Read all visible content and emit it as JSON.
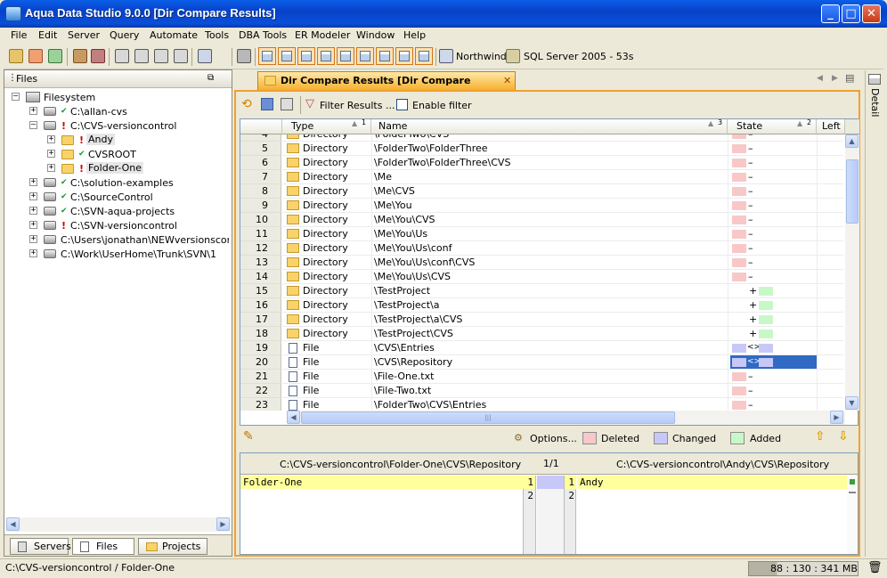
{
  "window": {
    "title": "Aqua Data Studio 9.0.0 [Dir Compare Results]"
  },
  "menu": [
    "File",
    "Edit",
    "Server",
    "Query",
    "Automate",
    "Tools",
    "DBA Tools",
    "ER Modeler",
    "Window",
    "Help"
  ],
  "toolbar": {
    "connection1": "Northwind",
    "connection2": "SQL Server 2005 - 53s"
  },
  "files_panel": {
    "title": "Files",
    "root": "Filesystem",
    "items": [
      {
        "label": "C:\\allan-cvs",
        "status": "ok"
      },
      {
        "label": "C:\\CVS-versioncontrol",
        "status": "changed"
      },
      {
        "label": "Andy",
        "status": "changed"
      },
      {
        "label": "CVSROOT",
        "status": "ok"
      },
      {
        "label": "Folder-One",
        "status": "changed"
      },
      {
        "label": "C:\\solution-examples",
        "status": "ok"
      },
      {
        "label": "C:\\SourceControl",
        "status": "ok"
      },
      {
        "label": "C:\\SVN-aqua-projects",
        "status": "ok"
      },
      {
        "label": "C:\\SVN-versioncontrol",
        "status": "changed"
      },
      {
        "label": "C:\\Users\\jonathan\\NEWversionscontro",
        "status": "none"
      },
      {
        "label": "C:\\Work\\UserHome\\Trunk\\SVN\\1",
        "status": "none"
      }
    ],
    "tabs": [
      "Servers",
      "Files",
      "Projects"
    ]
  },
  "doc_tab": {
    "label": "Dir Compare Results [Dir Compare Results]"
  },
  "side_tab": {
    "label": "Detail"
  },
  "filter": {
    "filter_label": "Filter Results ...",
    "enable_label": "Enable filter"
  },
  "grid": {
    "headers": {
      "type": "Type",
      "type_sort": "1",
      "name": "Name",
      "name_sort": "3",
      "state": "State",
      "state_sort": "2",
      "left": "Left"
    },
    "rows": [
      {
        "num": "4",
        "type": "Directory",
        "name": "\\FolderTwo\\CVS",
        "state": "deleted"
      },
      {
        "num": "5",
        "type": "Directory",
        "name": "\\FolderTwo\\FolderThree",
        "state": "deleted"
      },
      {
        "num": "6",
        "type": "Directory",
        "name": "\\FolderTwo\\FolderThree\\CVS",
        "state": "deleted"
      },
      {
        "num": "7",
        "type": "Directory",
        "name": "\\Me",
        "state": "deleted"
      },
      {
        "num": "8",
        "type": "Directory",
        "name": "\\Me\\CVS",
        "state": "deleted"
      },
      {
        "num": "9",
        "type": "Directory",
        "name": "\\Me\\You",
        "state": "deleted"
      },
      {
        "num": "10",
        "type": "Directory",
        "name": "\\Me\\You\\CVS",
        "state": "deleted"
      },
      {
        "num": "11",
        "type": "Directory",
        "name": "\\Me\\You\\Us",
        "state": "deleted"
      },
      {
        "num": "12",
        "type": "Directory",
        "name": "\\Me\\You\\Us\\conf",
        "state": "deleted"
      },
      {
        "num": "13",
        "type": "Directory",
        "name": "\\Me\\You\\Us\\conf\\CVS",
        "state": "deleted"
      },
      {
        "num": "14",
        "type": "Directory",
        "name": "\\Me\\You\\Us\\CVS",
        "state": "deleted"
      },
      {
        "num": "15",
        "type": "Directory",
        "name": "\\TestProject",
        "state": "added"
      },
      {
        "num": "16",
        "type": "Directory",
        "name": "\\TestProject\\a",
        "state": "added"
      },
      {
        "num": "17",
        "type": "Directory",
        "name": "\\TestProject\\a\\CVS",
        "state": "added"
      },
      {
        "num": "18",
        "type": "Directory",
        "name": "\\TestProject\\CVS",
        "state": "added"
      },
      {
        "num": "19",
        "type": "File",
        "name": "\\CVS\\Entries",
        "state": "changed"
      },
      {
        "num": "20",
        "type": "File",
        "name": "\\CVS\\Repository",
        "state": "changed_selected"
      },
      {
        "num": "21",
        "type": "File",
        "name": "\\File-One.txt",
        "state": "deleted"
      },
      {
        "num": "22",
        "type": "File",
        "name": "\\File-Two.txt",
        "state": "deleted"
      },
      {
        "num": "23",
        "type": "File",
        "name": "\\FolderTwo\\CVS\\Entries",
        "state": "deleted"
      }
    ],
    "symbols": {
      "deleted": "–",
      "added": "+",
      "changed": "<>"
    }
  },
  "legend": {
    "options": "Options...",
    "deleted": "Deleted",
    "changed": "Changed",
    "added": "Added",
    "colors": {
      "deleted": "#f8c8c8",
      "changed": "#c8c8f8",
      "added": "#c8f8c8",
      "highlight": "#ffff9c"
    }
  },
  "compare": {
    "left_path": "C:\\CVS-versioncontrol\\Folder-One\\CVS\\Repository",
    "right_path": "C:\\CVS-versioncontrol\\Andy\\CVS\\Repository",
    "position": "1/1",
    "left_lines": [
      {
        "n": "1",
        "text": "Folder-One"
      },
      {
        "n": "2",
        "text": ""
      }
    ],
    "right_lines": [
      {
        "n": "1",
        "text": "Andy"
      },
      {
        "n": "2",
        "text": ""
      }
    ]
  },
  "status": {
    "path": "C:\\CVS-versioncontrol / Folder-One",
    "memory": "88 : 130 : 341 MB"
  }
}
